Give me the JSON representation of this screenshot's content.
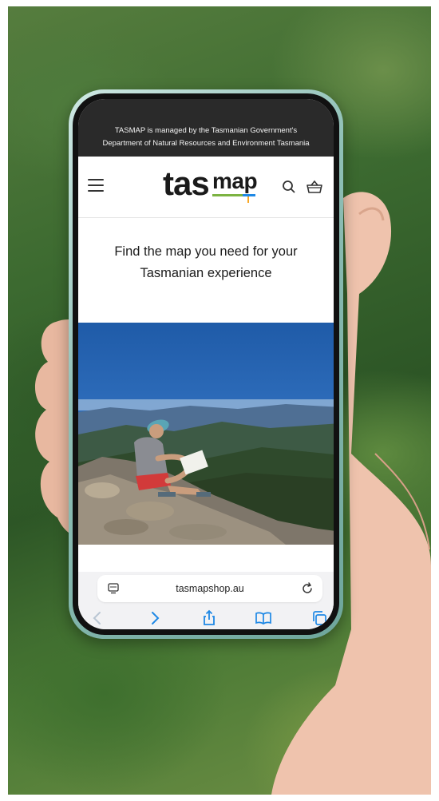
{
  "banner": {
    "line1": "TASMAP is managed by the Tasmanian Government's",
    "line2": "Department of Natural Resources and Environment Tasmania"
  },
  "header": {
    "logo_part1": "tas",
    "logo_part2": "map",
    "icons": [
      "menu-icon",
      "search-icon",
      "basket-icon"
    ]
  },
  "tagline": {
    "line1": "Find the map you need for your",
    "line2": "Tasmanian experience"
  },
  "browser": {
    "url": "tasmapshop.au",
    "toolbar_icons": [
      "back-icon",
      "forward-icon",
      "share-icon",
      "bookmarks-icon",
      "tabs-icon"
    ]
  },
  "colors": {
    "accent": "#1e88e5",
    "banner_bg": "#2a2a2a",
    "logo_green": "#7cb342",
    "logo_yellow": "#f9a825"
  }
}
